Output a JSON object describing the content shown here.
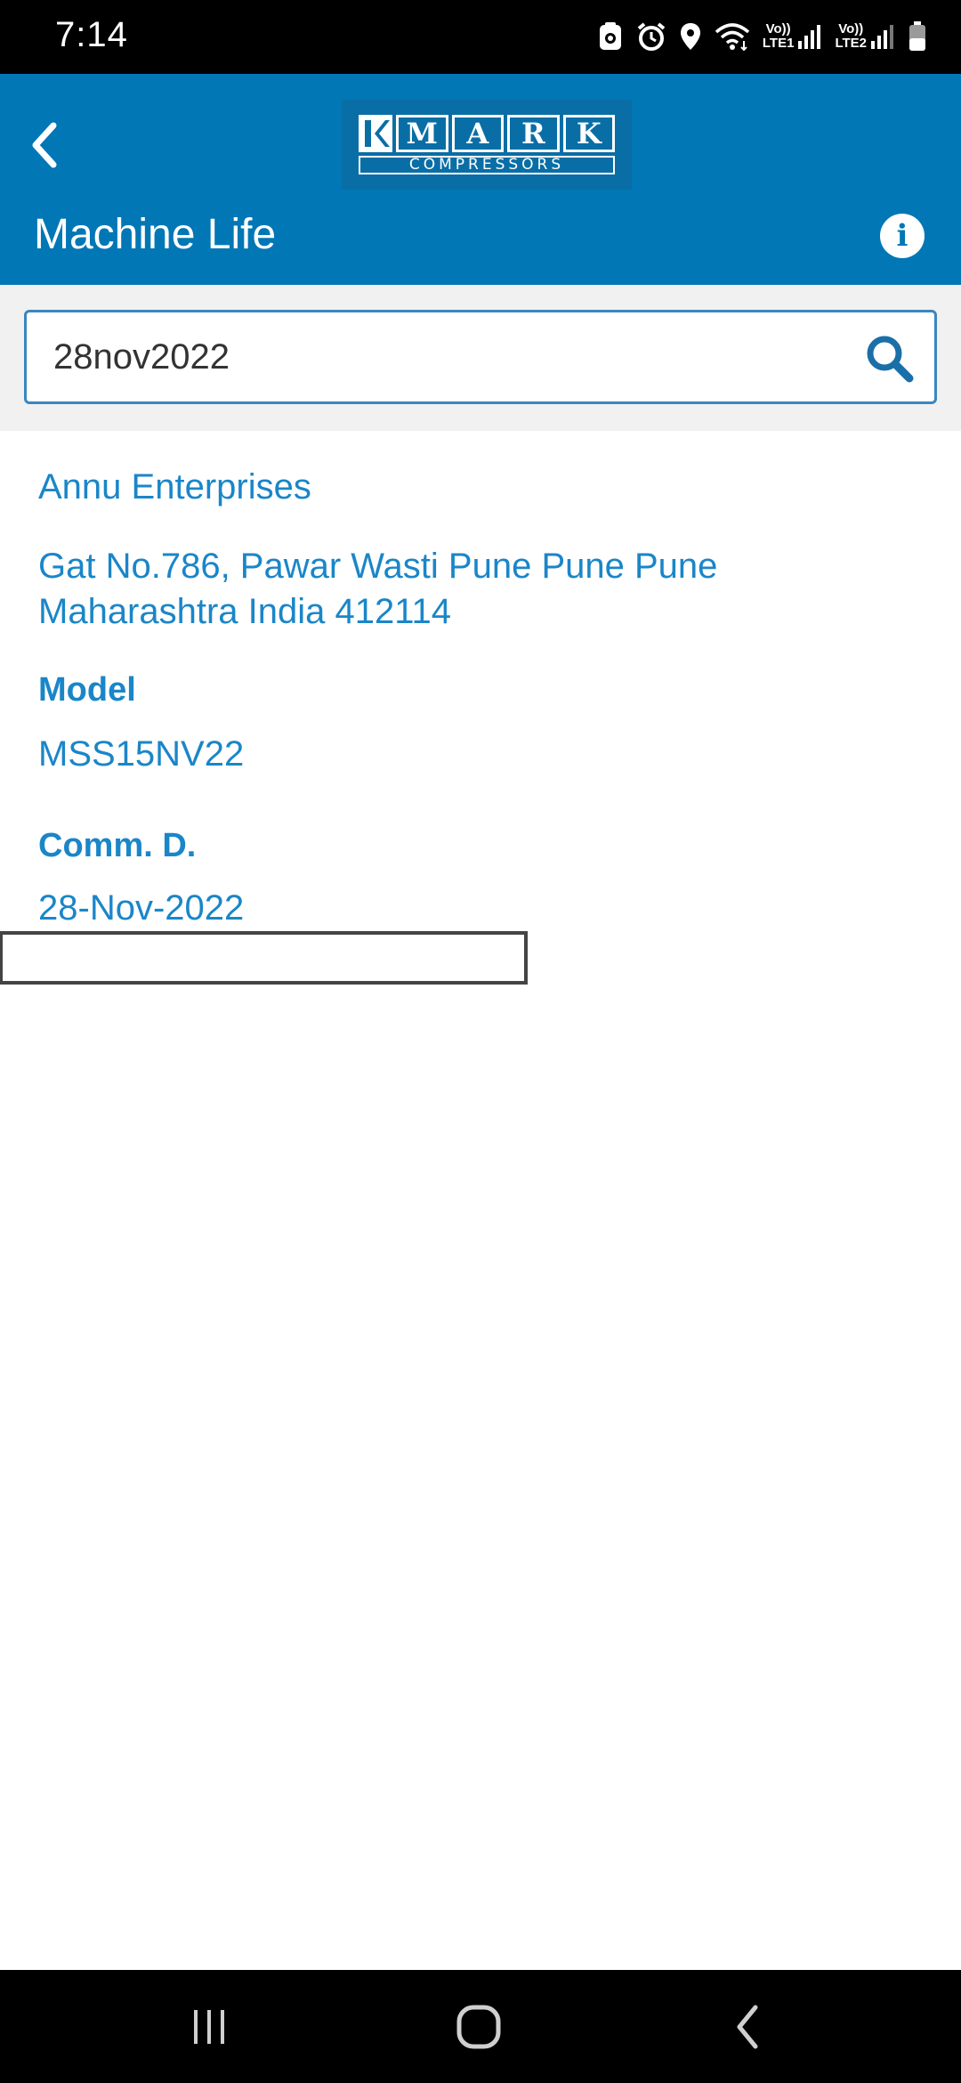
{
  "status_bar": {
    "time": "7:14",
    "icons": [
      "app-notification-icon",
      "alarm-icon",
      "location-icon",
      "wifi-icon",
      "signal-lte1-icon",
      "signal-lte2-icon",
      "battery-icon"
    ],
    "sim1_label_top": "Vo))",
    "sim1_label_bottom": "LTE1",
    "sim2_label_top": "Vo))",
    "sim2_label_bottom": "LTE2"
  },
  "header": {
    "logo_word": [
      "M",
      "A",
      "R",
      "K"
    ],
    "logo_tagline": "COMPRESSORS",
    "title": "Machine Life",
    "info_label": "i",
    "back_icon": "chevron-left-icon",
    "info_icon": "info-icon"
  },
  "search": {
    "value": "28nov2022",
    "placeholder": "",
    "icon": "search-icon"
  },
  "details": {
    "company_name": "Annu Enterprises",
    "address": "Gat No.786, Pawar Wasti Pune Pune Pune Maharashtra India 412114",
    "model_label": "Model",
    "model_value": "MSS15NV22",
    "comm_label": "Comm. D.",
    "comm_value": "28-Nov-2022"
  },
  "nav_bar": {
    "icons": [
      "recents-icon",
      "home-icon",
      "back-icon"
    ]
  },
  "colors": {
    "header_bg": "#0277b6",
    "text_accent": "#1a86c8",
    "search_border": "#3a86c0",
    "search_bg_area": "#f1f1f1"
  }
}
